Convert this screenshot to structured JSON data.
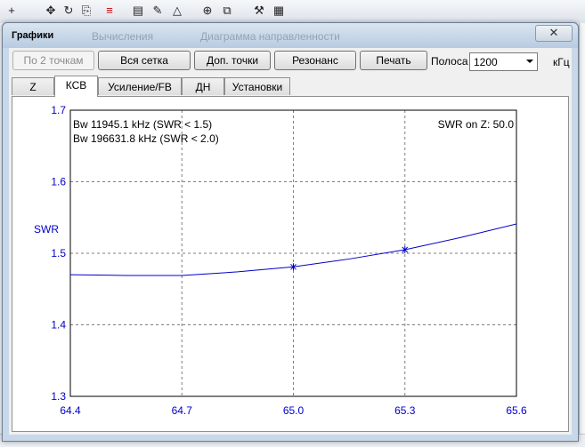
{
  "window": {
    "title": "Графики",
    "ghost_tabs": [
      "Вычисления",
      "Диаграмма направленности"
    ],
    "close_glyph": "✕"
  },
  "toolbar": {
    "buttons": [
      "По 2 точкам",
      "Вся сетка",
      "Доп. точки",
      "Резонанс",
      "Печать"
    ],
    "band_label": "Полоса",
    "band_value": "1200",
    "band_unit": "кГц"
  },
  "tabs": [
    "Z",
    "КСВ",
    "Усиление/FB",
    "ДН",
    "Установки"
  ],
  "active_tab": 1,
  "icons": [
    "move-icon",
    "rotate-icon",
    "edit-icon",
    "ladder-icon",
    "document-icon",
    "pen-icon",
    "triangle-icon",
    "crosshair-icon",
    "copy-icon",
    "tools-icon",
    "calculator-icon"
  ],
  "colors": {
    "series": "#0000c8",
    "axis_text": "#0000c8",
    "grid": "#7f7f7f"
  },
  "chart_data": {
    "type": "line",
    "ylabel": "SWR",
    "xlabel": "",
    "xlim": [
      64.4,
      65.6
    ],
    "ylim": [
      1.3,
      1.7
    ],
    "x_ticks": [
      "64.4",
      "64.7",
      "65.0",
      "65.3",
      "65.6"
    ],
    "y_ticks": [
      "1.3",
      "1.4",
      "1.5",
      "1.6",
      "1.7"
    ],
    "grid": true,
    "annotations": [
      "Bw 11945.1 kHz (SWR < 1.5)",
      "Bw 196631.8 kHz (SWR < 2.0)"
    ],
    "annotation_right": "SWR on Z: 50.0",
    "series": [
      {
        "x": [
          64.4,
          64.55,
          64.7,
          64.85,
          65.0,
          65.15,
          65.3,
          65.45,
          65.6
        ],
        "y": [
          1.47,
          1.469,
          1.469,
          1.474,
          1.481,
          1.492,
          1.505,
          1.522,
          1.541
        ],
        "markers": [
          65.0,
          65.3
        ]
      }
    ]
  }
}
